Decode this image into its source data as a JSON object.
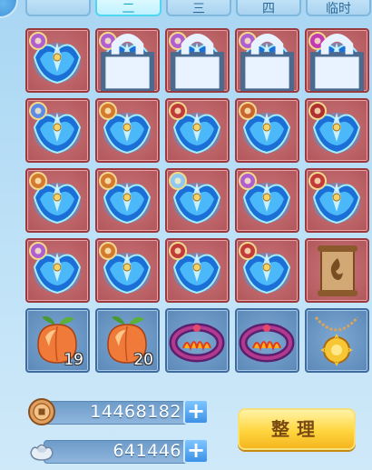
{
  "tabs": [
    {
      "label": ""
    },
    {
      "label": "二"
    },
    {
      "label": "三"
    },
    {
      "label": "四"
    },
    {
      "label": "临时"
    }
  ],
  "grid": [
    {
      "kind": "equip",
      "icon": "wing-necklace-icon",
      "frame": "red",
      "badge": "#b05fd0",
      "locked": false
    },
    {
      "kind": "equip",
      "icon": "wing-necklace-icon",
      "frame": "red",
      "badge": "#b05fd0",
      "locked": true
    },
    {
      "kind": "equip",
      "icon": "wing-necklace-icon",
      "frame": "red",
      "badge": "#b05fd0",
      "locked": true
    },
    {
      "kind": "equip",
      "icon": "wing-pendant-icon",
      "frame": "red",
      "badge": "#b05fd0",
      "locked": true
    },
    {
      "kind": "equip",
      "icon": "wing-pendant-icon",
      "frame": "red",
      "badge": "#c43ab5",
      "locked": true
    },
    {
      "kind": "equip",
      "icon": "wing-pendant-icon",
      "frame": "red",
      "badge": "#5d8be6",
      "locked": false
    },
    {
      "kind": "equip",
      "icon": "crystal-armor-icon",
      "frame": "red",
      "badge": "#d47a2f",
      "locked": false
    },
    {
      "kind": "equip",
      "icon": "crystal-armor-icon",
      "frame": "red",
      "badge": "#c23a3a",
      "locked": false
    },
    {
      "kind": "equip",
      "icon": "crystal-armor-icon",
      "frame": "red",
      "badge": "#c9662f",
      "locked": false
    },
    {
      "kind": "equip",
      "icon": "crystal-armor-icon",
      "frame": "red",
      "badge": "#b03030",
      "locked": false
    },
    {
      "kind": "equip",
      "icon": "crystal-armor-icon",
      "frame": "red",
      "badge": "#d47a2f",
      "locked": false
    },
    {
      "kind": "equip",
      "icon": "crystal-armor-icon",
      "frame": "red",
      "badge": "#d47a2f",
      "locked": false
    },
    {
      "kind": "equip",
      "icon": "crystal-armor-icon",
      "frame": "red",
      "badge": "#8fc8f0",
      "locked": false
    },
    {
      "kind": "equip",
      "icon": "crystal-armor-icon",
      "frame": "red",
      "badge": "#b05fd0",
      "locked": false
    },
    {
      "kind": "equip",
      "icon": "crystal-robe-icon",
      "frame": "red",
      "badge": "#c23a3a",
      "locked": false
    },
    {
      "kind": "equip",
      "icon": "crystal-robe-icon",
      "frame": "red",
      "badge": "#b05fd0",
      "locked": false
    },
    {
      "kind": "equip",
      "icon": "crystal-robe-icon",
      "frame": "red",
      "badge": "#d47a2f",
      "locked": false
    },
    {
      "kind": "equip",
      "icon": "crystal-helmet-icon",
      "frame": "red",
      "badge": "#c23a3a",
      "locked": false
    },
    {
      "kind": "equip",
      "icon": "crystal-helmet-icon",
      "frame": "red",
      "badge": "#c23a3a",
      "locked": false
    },
    {
      "kind": "scroll",
      "icon": "scroll-icon",
      "frame": "red",
      "badge": "",
      "locked": false
    },
    {
      "kind": "peach",
      "icon": "peach-icon",
      "frame": "blue",
      "badge": "",
      "locked": false,
      "qty": "19"
    },
    {
      "kind": "peach",
      "icon": "peach-icon",
      "frame": "blue",
      "badge": "",
      "locked": false,
      "qty": "20"
    },
    {
      "kind": "ring",
      "icon": "fire-bracelet-icon",
      "frame": "blue",
      "badge": "",
      "locked": false
    },
    {
      "kind": "ring",
      "icon": "fire-bracelet-icon",
      "frame": "blue",
      "badge": "",
      "locked": false
    },
    {
      "kind": "amulet",
      "icon": "sun-amulet-icon",
      "frame": "blue",
      "badge": "",
      "locked": false
    }
  ],
  "currency": {
    "coins": {
      "value": "14468182",
      "icon": "copper-coin-icon"
    },
    "silver": {
      "value": "641446",
      "icon": "silver-ingot-icon"
    }
  },
  "sort_button": {
    "label": "整理"
  },
  "colors": {
    "accent": "#4fd7ef",
    "slot_red": "#b2575c",
    "slot_blue": "#5b88b8",
    "button_gold": "#ffd640"
  }
}
